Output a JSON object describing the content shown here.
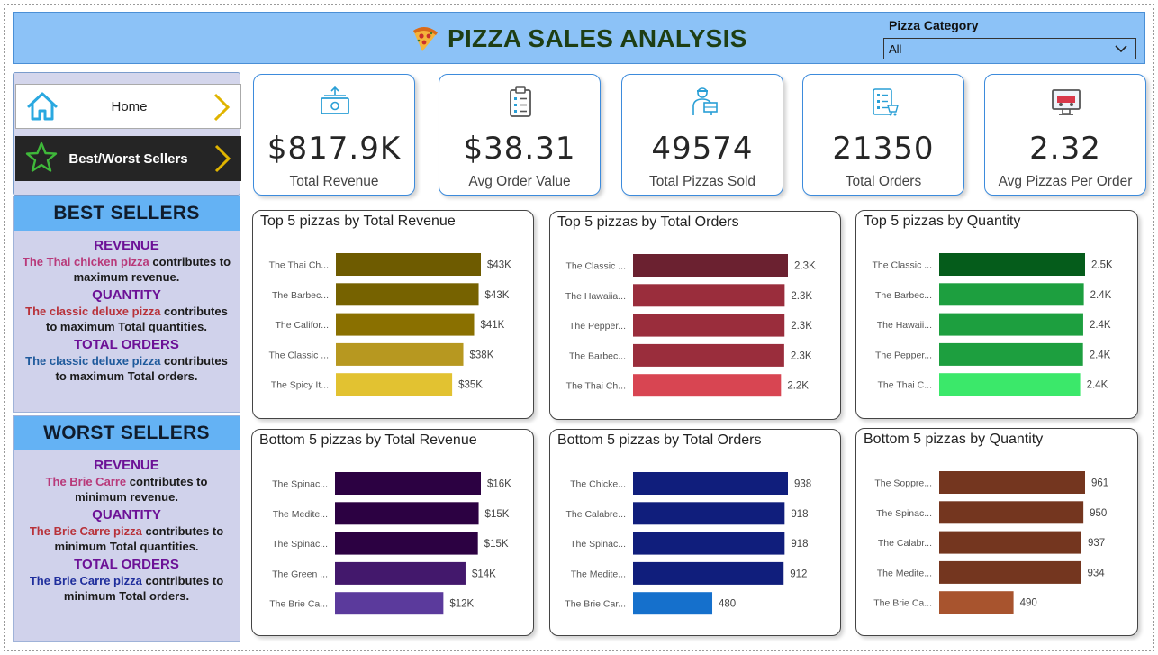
{
  "header": {
    "title": "PIZZA SALES ANALYSIS",
    "icon": "pizza-slice-icon"
  },
  "filter": {
    "label": "Pizza Category",
    "value": "All"
  },
  "nav": {
    "home_label": "Home",
    "best_worst_label": "Best/Worst Sellers"
  },
  "best_sellers": {
    "heading": "BEST SELLERS",
    "sections": [
      {
        "title": "REVENUE",
        "highlight": "The Thai chicken pizza",
        "highlight_color": "#b83a7a",
        "text": "contributes to maximum revenue."
      },
      {
        "title": "QUANTITY",
        "highlight": "The classic deluxe pizza",
        "highlight_color": "#b8323a",
        "text": "contributes to maximum Total quantities."
      },
      {
        "title": "TOTAL ORDERS",
        "highlight": "The classic deluxe pizza",
        "highlight_color": "#1f5a9c",
        "text": "contributes to maximum Total orders."
      }
    ]
  },
  "worst_sellers": {
    "heading": "WORST SELLERS",
    "sections": [
      {
        "title": "REVENUE",
        "highlight": "The Brie Carre",
        "highlight_color": "#b83a7a",
        "text": "contributes to minimum revenue."
      },
      {
        "title": "QUANTITY",
        "highlight": "The Brie Carre pizza",
        "highlight_color": "#b8323a",
        "text": "contributes to minimum Total quantities."
      },
      {
        "title": "TOTAL ORDERS",
        "highlight": "The Brie Carre pizza",
        "highlight_color": "#1f2e9c",
        "text": "contributes to minimum Total orders."
      }
    ]
  },
  "kpis": [
    {
      "value": "$817.9K",
      "label": "Total Revenue",
      "icon": "money-icon"
    },
    {
      "value": "$38.31",
      "label": "Avg Order Value",
      "icon": "clipboard-icon"
    },
    {
      "value": "49574",
      "label": "Total Pizzas Sold",
      "icon": "delivery-person-icon"
    },
    {
      "value": "21350",
      "label": "Total Orders",
      "icon": "order-list-icon"
    },
    {
      "value": "2.32",
      "label": "Avg Pizzas Per Order",
      "icon": "monitor-icon"
    }
  ],
  "chart_data": [
    {
      "type": "bar",
      "orientation": "horizontal",
      "title": "Top 5 pizzas by Total Revenue",
      "categories": [
        "The Thai Ch...",
        "The Barbec...",
        "The Califor...",
        "The Classic ...",
        "The Spicy It..."
      ],
      "values": [
        43434,
        42768,
        41410,
        38180,
        34832
      ],
      "data_labels": [
        "$43K",
        "$43K",
        "$41K",
        "$38K",
        "$35K"
      ],
      "colors": [
        "#6e5b00",
        "#766200",
        "#8a7000",
        "#b79820",
        "#e2c231"
      ]
    },
    {
      "type": "bar",
      "orientation": "horizontal",
      "title": "Top 5 pizzas by Total Orders",
      "categories": [
        "The Classic ...",
        "The Hawaiia...",
        "The Pepper...",
        "The Barbec...",
        "The Thai Ch..."
      ],
      "values": [
        2329,
        2280,
        2278,
        2273,
        2225
      ],
      "data_labels": [
        "2.3K",
        "2.3K",
        "2.3K",
        "2.3K",
        "2.2K"
      ],
      "colors": [
        "#6b2130",
        "#9a2d3c",
        "#9a2d3c",
        "#9a2d3c",
        "#d84552"
      ]
    },
    {
      "type": "bar",
      "orientation": "horizontal",
      "title": "Top 5 pizzas by Quantity",
      "categories": [
        "The Classic ...",
        "The Barbec...",
        "The Hawaii...",
        "The Pepper...",
        "The Thai C..."
      ],
      "values": [
        2453,
        2432,
        2422,
        2418,
        2371
      ],
      "data_labels": [
        "2.5K",
        "2.4K",
        "2.4K",
        "2.4K",
        "2.4K"
      ],
      "colors": [
        "#055c1b",
        "#1d9f3f",
        "#1d9f3f",
        "#1d9f3f",
        "#3be86a"
      ]
    },
    {
      "type": "bar",
      "orientation": "horizontal",
      "title": "Bottom 5 pizzas by Total Revenue",
      "categories": [
        "The Spinac...",
        "The Medite...",
        "The Spinac...",
        "The Green ...",
        "The Brie Ca..."
      ],
      "values": [
        15596,
        15360,
        15277,
        13956,
        11588
      ],
      "data_labels": [
        "$16K",
        "$15K",
        "$15K",
        "$14K",
        "$12K"
      ],
      "colors": [
        "#2c0142",
        "#2c0142",
        "#2c0142",
        "#43186c",
        "#5b3a9c"
      ]
    },
    {
      "type": "bar",
      "orientation": "horizontal",
      "title": "Bottom 5 pizzas by Total Orders",
      "categories": [
        "The Chicke...",
        "The Calabre...",
        "The Spinac...",
        "The Medite...",
        "The Brie Car..."
      ],
      "values": [
        938,
        918,
        918,
        912,
        480
      ],
      "data_labels": [
        "938",
        "918",
        "918",
        "912",
        "480"
      ],
      "colors": [
        "#101e7c",
        "#101e7c",
        "#101e7c",
        "#101e7c",
        "#1570cc"
      ]
    },
    {
      "type": "bar",
      "orientation": "horizontal",
      "title": "Bottom 5 pizzas by Quantity",
      "categories": [
        "The Soppre...",
        "The Spinac...",
        "The Calabr...",
        "The Medite...",
        "The Brie Ca..."
      ],
      "values": [
        961,
        950,
        937,
        934,
        490
      ],
      "data_labels": [
        "961",
        "950",
        "937",
        "934",
        "490"
      ],
      "colors": [
        "#74361f",
        "#74361f",
        "#74361f",
        "#74361f",
        "#a8542e"
      ]
    }
  ]
}
